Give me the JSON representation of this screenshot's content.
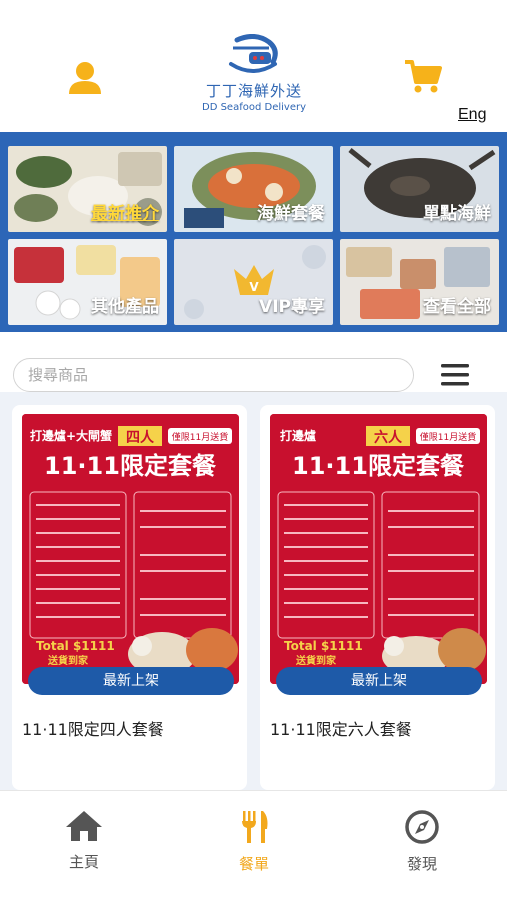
{
  "header": {
    "logo_cn": "丁丁海鮮外送",
    "logo_en": "DD Seafood Delivery",
    "lang_label": "Eng",
    "user_icon": "user-icon",
    "cart_icon": "cart-icon"
  },
  "categories": [
    {
      "label": "最新推介",
      "active": true
    },
    {
      "label": "海鮮套餐",
      "active": false
    },
    {
      "label": "單點海鮮",
      "active": false
    },
    {
      "label": "其他產品",
      "active": false
    },
    {
      "label": "VIP專享",
      "active": false
    },
    {
      "label": "查看全部",
      "active": false
    }
  ],
  "search": {
    "placeholder": "搜尋商品",
    "value": "",
    "menu_icon": "hamburger-menu-icon"
  },
  "products": [
    {
      "name": "11·11限定四人套餐",
      "badge": "最新上架",
      "poster": {
        "top_left": "打邊爐+大閘蟹",
        "persons": "四人",
        "tag": "僅限11月送貨",
        "title": "11·11限定套餐",
        "total": "Total $1111",
        "delivery": "送貨到家"
      }
    },
    {
      "name": "11·11限定六人套餐",
      "badge": "最新上架",
      "poster": {
        "top_left": "打邊爐",
        "persons": "六人",
        "tag": "僅限11月送貨",
        "title": "11·11限定套餐",
        "total": "Total $1111",
        "delivery": "送貨到家"
      }
    }
  ],
  "nav": {
    "home": "主頁",
    "menu": "餐單",
    "discover": "發現",
    "active": "menu"
  },
  "colors": {
    "brand_blue": "#2c66b7",
    "accent_yellow": "#f2a81d",
    "poster_red": "#c8102e",
    "badge_blue": "#1e5aa8"
  }
}
